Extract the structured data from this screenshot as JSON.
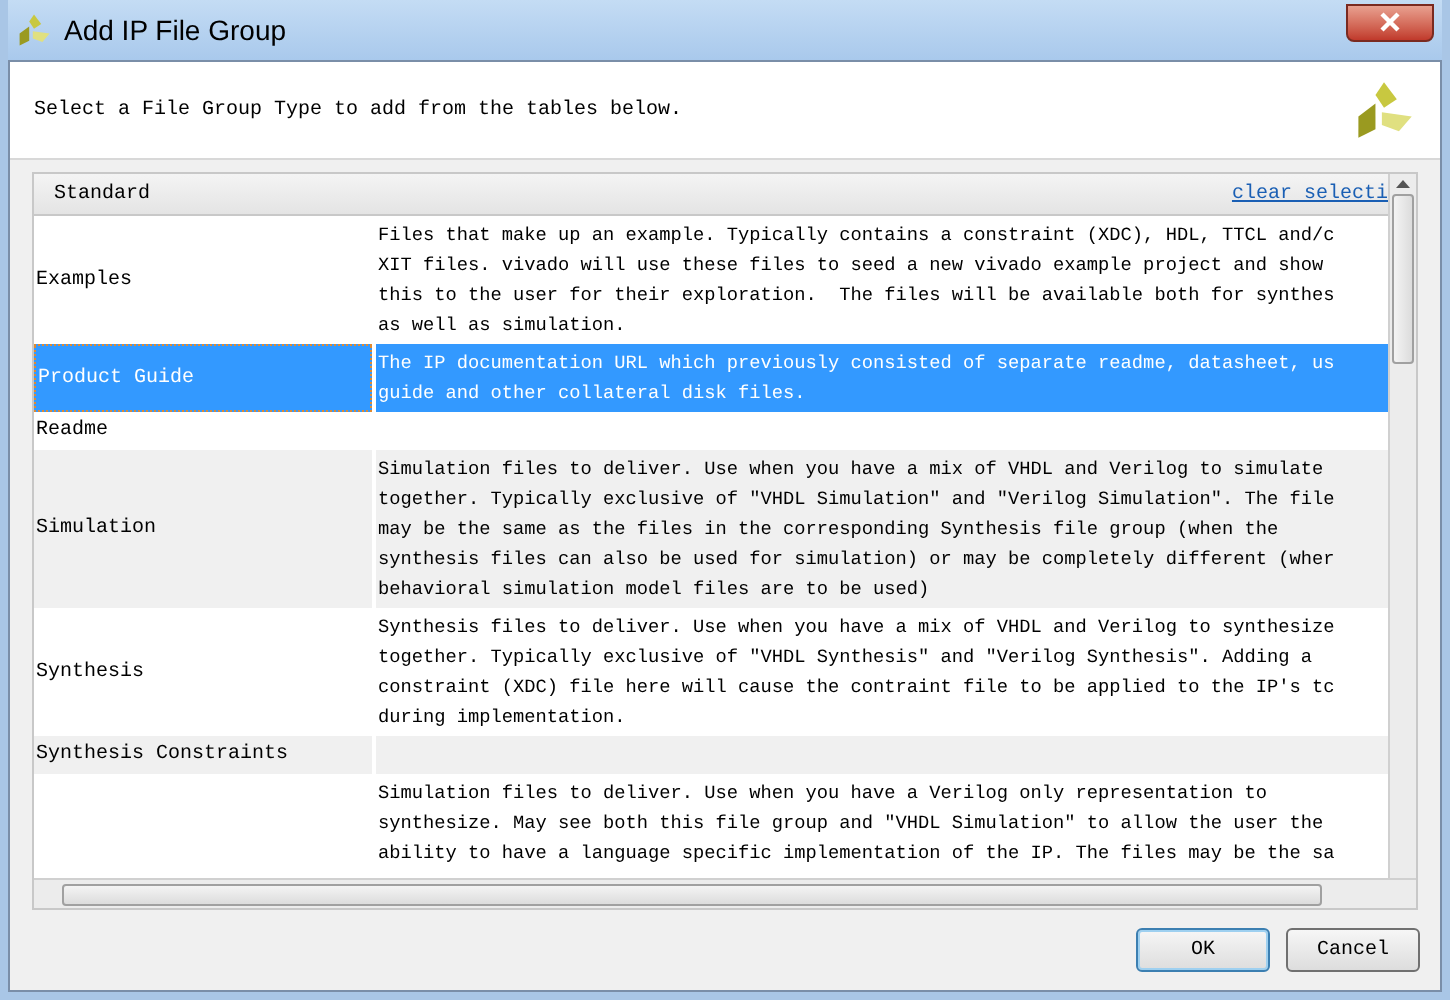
{
  "window": {
    "title": "Add IP File Group"
  },
  "instruction": "Select a File Group Type to add from the tables below.",
  "table": {
    "header": "Standard",
    "clear_link": "clear selecti",
    "rows": [
      {
        "name": "Examples",
        "selected": false,
        "lines": [
          "Files that make up an example. Typically contains a constraint (XDC), HDL, TTCL and/c",
          "XIT files. vivado will use these files to seed a new vivado example project and show",
          "this to the user for their exploration.  The files will be available both for synthes",
          "as well as simulation."
        ]
      },
      {
        "name": "Product Guide",
        "selected": true,
        "lines": [
          "The IP documentation URL which previously consisted of separate readme, datasheet, us",
          "guide and other collateral disk files."
        ]
      },
      {
        "name": "Readme",
        "selected": false,
        "lines": []
      },
      {
        "name": "Simulation",
        "selected": false,
        "lines": [
          "Simulation files to deliver. Use when you have a mix of VHDL and Verilog to simulate",
          "together. Typically exclusive of \"VHDL Simulation\" and \"Verilog Simulation\". The file",
          "may be the same as the files in the corresponding Synthesis file group (when the",
          "synthesis files can also be used for simulation) or may be completely different (wher",
          "behavioral simulation model files are to be used)"
        ]
      },
      {
        "name": "Synthesis",
        "selected": false,
        "lines": [
          "Synthesis files to deliver. Use when you have a mix of VHDL and Verilog to synthesize",
          "together. Typically exclusive of \"VHDL Synthesis\" and \"Verilog Synthesis\". Adding a",
          "constraint (XDC) file here will cause the contraint file to be applied to the IP's tc",
          "during implementation."
        ]
      },
      {
        "name": "Synthesis Constraints",
        "selected": false,
        "lines": []
      },
      {
        "name": "",
        "selected": false,
        "lines": [
          "Simulation files to deliver. Use when you have a Verilog only representation to",
          "synthesize. May see both this file group and \"VHDL Simulation\" to allow the user the",
          "ability to have a language specific implementation of the IP. The files may be the sa"
        ]
      }
    ]
  },
  "buttons": [
    {
      "label": "OK",
      "default": true
    },
    {
      "label": "Cancel",
      "default": false
    }
  ]
}
